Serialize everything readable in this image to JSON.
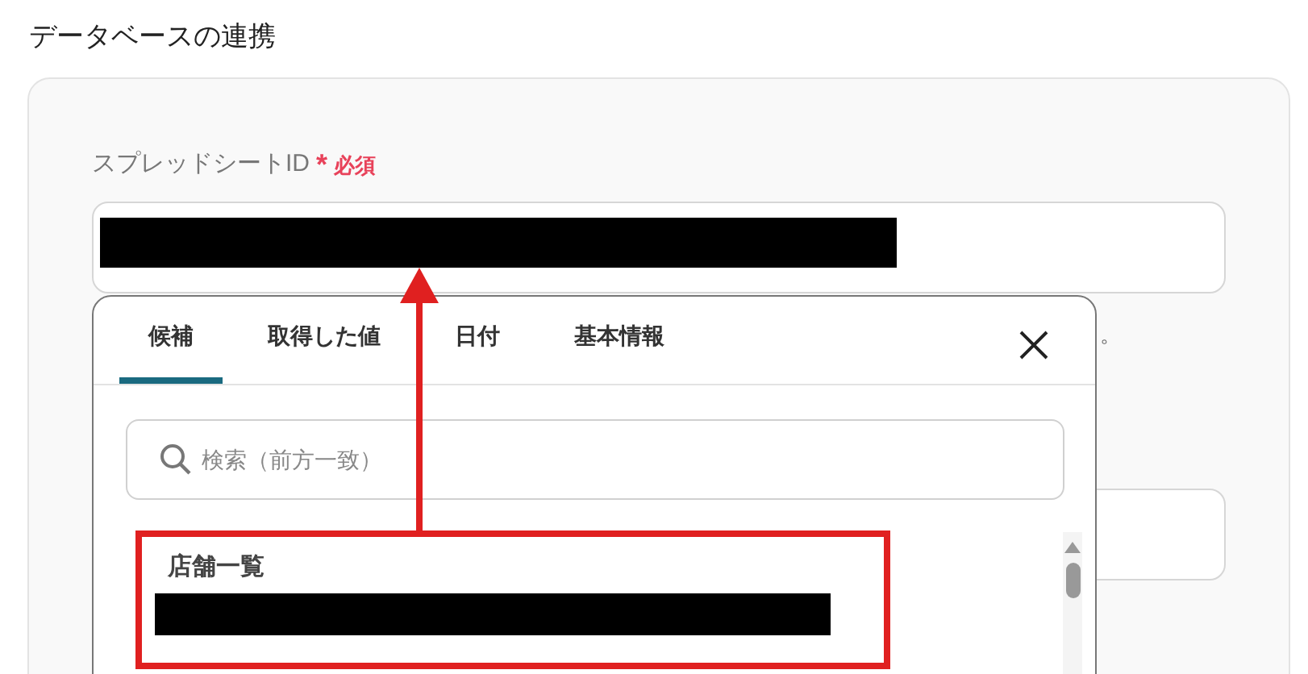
{
  "section_title": "データベースの連携",
  "field": {
    "label": "スプレッドシートID",
    "required_mark": "*",
    "required_text": "必須"
  },
  "hint_tail": "。",
  "popup": {
    "tabs": [
      {
        "label": "候補",
        "selected": true
      },
      {
        "label": "取得した値",
        "selected": false
      },
      {
        "label": "日付",
        "selected": false
      },
      {
        "label": "基本情報",
        "selected": false
      }
    ],
    "search": {
      "placeholder": "検索（前方一致）"
    },
    "items": [
      {
        "title": "店舗一覧"
      }
    ]
  }
}
